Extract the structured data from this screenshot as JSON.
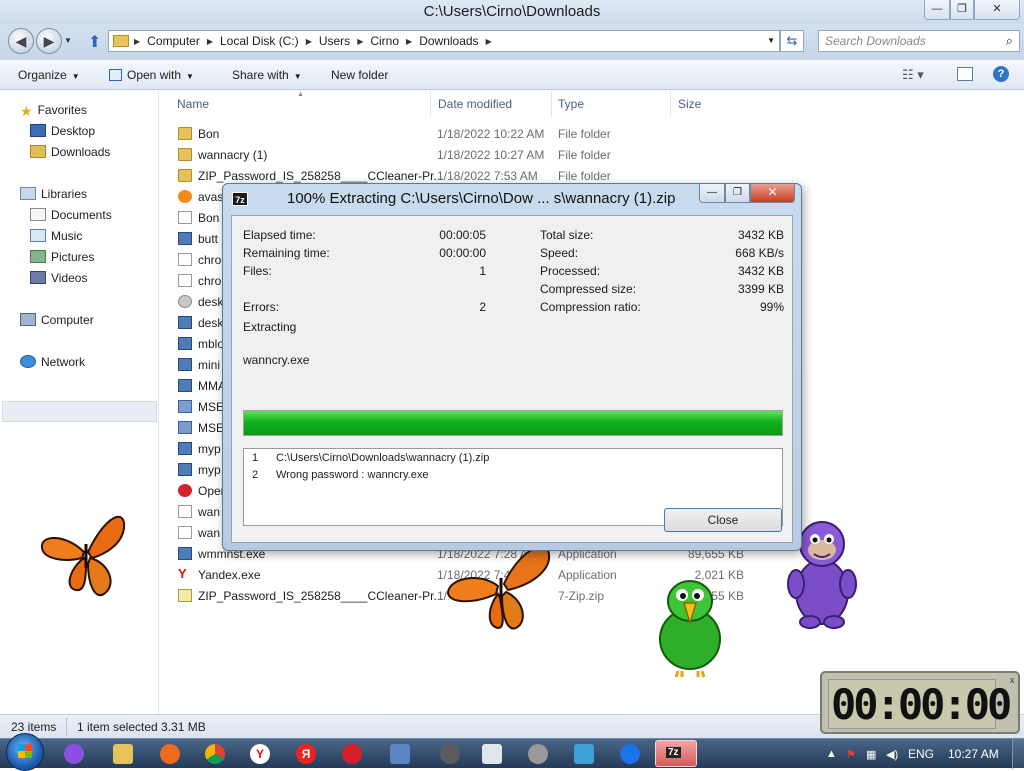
{
  "window": {
    "title": "C:\\Users\\Cirno\\Downloads",
    "min_glyph": "—",
    "max_glyph": "❐",
    "close_glyph": "✕"
  },
  "address": {
    "segments": [
      "Computer",
      "Local Disk (C:)",
      "Users",
      "Cirno",
      "Downloads"
    ],
    "search_placeholder": "Search Downloads"
  },
  "toolbar": {
    "organize": "Organize",
    "open_with": "Open with",
    "share_with": "Share with",
    "new_folder": "New folder",
    "help": "?"
  },
  "nav": {
    "favorites": "Favorites",
    "desktop": "Desktop",
    "downloads": "Downloads",
    "libraries": "Libraries",
    "documents": "Documents",
    "music": "Music",
    "pictures": "Pictures",
    "videos": "Videos",
    "computer": "Computer",
    "network": "Network"
  },
  "columns": {
    "name": "Name",
    "date": "Date modified",
    "type": "Type",
    "size": "Size"
  },
  "files": [
    {
      "name": "Bon",
      "date": "1/18/2022 10:22 AM",
      "type": "File folder",
      "size": "",
      "icon": "folder"
    },
    {
      "name": "wannacry (1)",
      "date": "1/18/2022 10:27 AM",
      "type": "File folder",
      "size": "",
      "icon": "folder"
    },
    {
      "name": "ZIP_Password_IS_258258____CCleaner-Pr...",
      "date": "1/18/2022 7:53 AM",
      "type": "File folder",
      "size": "",
      "icon": "folder"
    },
    {
      "name": "avast",
      "date": "",
      "type": "",
      "size": "",
      "icon": "avast"
    },
    {
      "name": "Bon",
      "date": "",
      "type": "",
      "size": "",
      "icon": "doc"
    },
    {
      "name": "butt",
      "date": "",
      "type": "",
      "size": "",
      "icon": "exe"
    },
    {
      "name": "chro",
      "date": "",
      "type": "",
      "size": "",
      "icon": "doc"
    },
    {
      "name": "chro",
      "date": "",
      "type": "",
      "size": "",
      "icon": "doc"
    },
    {
      "name": "desk",
      "date": "",
      "type": "",
      "size": "",
      "icon": "gear"
    },
    {
      "name": "desk",
      "date": "",
      "type": "",
      "size": "",
      "icon": "exe"
    },
    {
      "name": "mblo",
      "date": "",
      "type": "",
      "size": "",
      "icon": "exe"
    },
    {
      "name": "mini",
      "date": "",
      "type": "",
      "size": "",
      "icon": "exe"
    },
    {
      "name": "MMA",
      "date": "",
      "type": "",
      "size": "",
      "icon": "exe"
    },
    {
      "name": "MSE",
      "date": "",
      "type": "",
      "size": "",
      "icon": "msn"
    },
    {
      "name": "MSE",
      "date": "",
      "type": "",
      "size": "",
      "icon": "msn"
    },
    {
      "name": "myp",
      "date": "",
      "type": "",
      "size": "",
      "icon": "exe"
    },
    {
      "name": "myp",
      "date": "",
      "type": "",
      "size": "",
      "icon": "exe"
    },
    {
      "name": "Oper",
      "date": "",
      "type": "",
      "size": "",
      "icon": "opera"
    },
    {
      "name": "wan",
      "date": "",
      "type": "",
      "size": "",
      "icon": "doc"
    },
    {
      "name": "wan",
      "date": "",
      "type": "",
      "size": "",
      "icon": "doc"
    },
    {
      "name": "wmmnst.exe",
      "date": "1/18/2022 7:28 AM",
      "type": "Application",
      "size": "89,655 KB",
      "icon": "exe"
    },
    {
      "name": "Yandex.exe",
      "date": "1/18/2022 7:49",
      "type": "Application",
      "size": "2,021 KB",
      "icon": "y"
    },
    {
      "name": "ZIP_Password_IS_258258____CCleaner-Pr...",
      "date": "1/",
      "type": "7-Zip.zip",
      "size": "155 KB",
      "icon": "zip"
    }
  ],
  "status": {
    "count": "23 items",
    "selected": "1 item selected  3.31 MB"
  },
  "dialog": {
    "icon_label": "7z",
    "title": "100% Extracting C:\\Users\\Cirno\\Dow ... s\\wannacry (1).zip",
    "elapsed_label": "Elapsed time:",
    "elapsed": "00:00:05",
    "remaining_label": "Remaining time:",
    "remaining": "00:00:00",
    "files_label": "Files:",
    "files": "1",
    "errors_label": "Errors:",
    "errors": "2",
    "total_label": "Total size:",
    "total": "3432 KB",
    "speed_label": "Speed:",
    "speed": "668 KB/s",
    "processed_label": "Processed:",
    "processed": "3432 KB",
    "compressed_label": "Compressed size:",
    "compressed": "3399 KB",
    "ratio_label": "Compression ratio:",
    "ratio": "99%",
    "status": "Extracting",
    "current_file": "wanncry.exe",
    "progress": 1.0,
    "log": [
      {
        "n": "1",
        "text": "C:\\Users\\Cirno\\Downloads\\wannacry (1).zip"
      },
      {
        "n": "2",
        "text": "Wrong password : wanncry.exe"
      }
    ],
    "close": "Close"
  },
  "timer": {
    "value": "00:00:00",
    "close_glyph": "x"
  },
  "taskbar": {
    "lang": "ENG",
    "clock": "10:27 AM",
    "task_label": "7z"
  },
  "colors": {
    "progress": "#0fb21a",
    "accent": "#2f74c8"
  }
}
